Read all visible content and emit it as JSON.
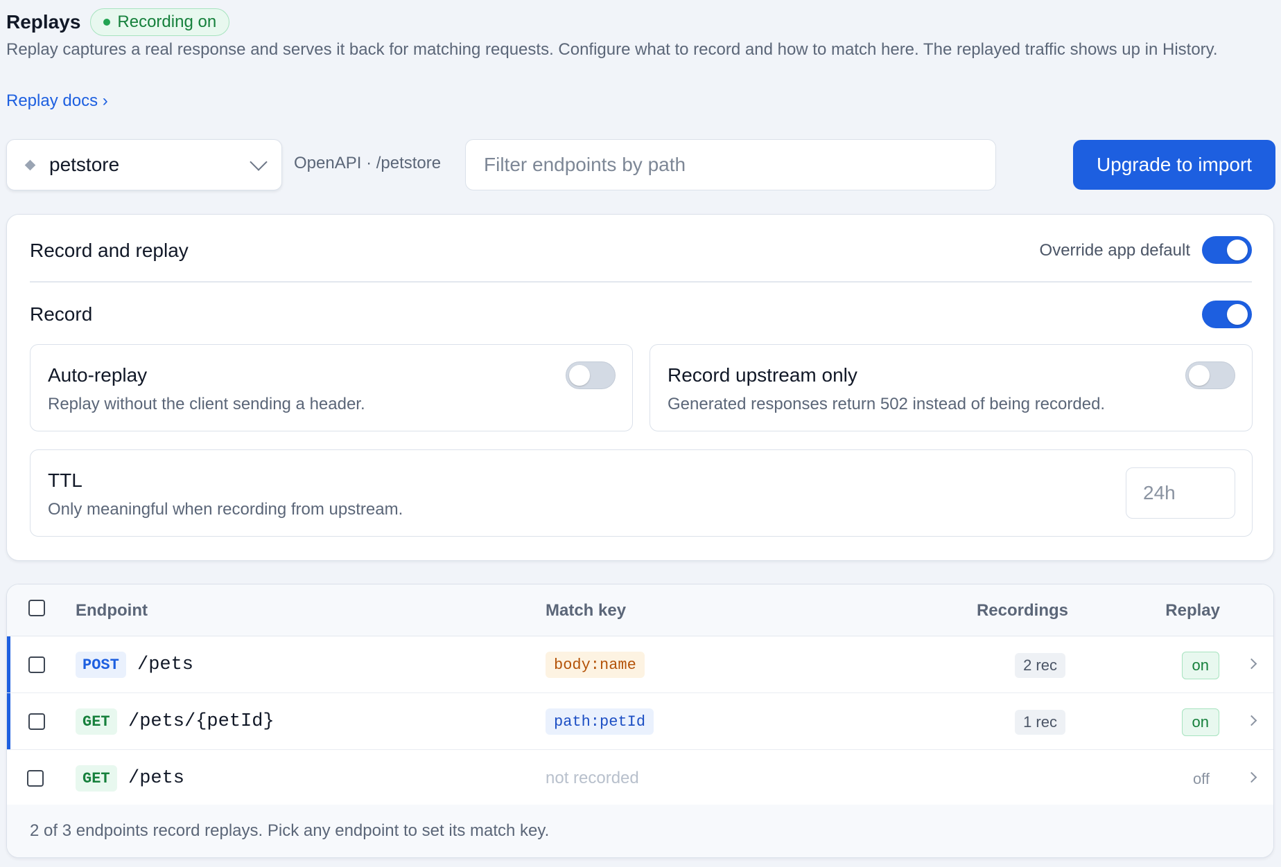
{
  "header": {
    "title": "Replays",
    "badge": "Recording on",
    "description": "Replay captures a real response and serves it back for matching requests. Configure what to record and how to match here. The replayed traffic shows up in History.",
    "docs_link": "Replay docs ›"
  },
  "toolbar": {
    "app_select": "petstore",
    "spec_label": "OpenAPI · /petstore",
    "filter_placeholder": "Filter endpoints by path",
    "filter_value": "",
    "upgrade_button": "Upgrade to import"
  },
  "settings": {
    "title": "Record and replay",
    "override_label": "Override app default",
    "override_on": true,
    "record_label": "Record",
    "record_on": true,
    "auto_replay": {
      "title": "Auto-replay",
      "description": "Replay without the client sending a header.",
      "on": false
    },
    "upstream_only": {
      "title": "Record upstream only",
      "description": "Generated responses return 502 instead of being recorded.",
      "on": false
    },
    "ttl": {
      "title": "TTL",
      "description": "Only meaningful when recording from upstream.",
      "placeholder": "24h"
    }
  },
  "table": {
    "columns": {
      "endpoint": "Endpoint",
      "match_key": "Match key",
      "recordings": "Recordings",
      "replay": "Replay"
    },
    "rows": [
      {
        "method": "POST",
        "path": "/pets",
        "match_key": "body:name",
        "recordings": "2 rec",
        "replay": "on"
      },
      {
        "method": "GET",
        "path": "/pets/{petId}",
        "match_key": "path:petId",
        "recordings": "1 rec",
        "replay": "on"
      },
      {
        "method": "GET",
        "path": "/pets",
        "match_key": "not recorded",
        "recordings": "",
        "replay": "off"
      }
    ],
    "footer": "2 of 3 endpoints record replays. Pick any endpoint to set its match key."
  },
  "colors": {
    "accent": "#1d5fe0",
    "success": "#16803c",
    "warning_text": "#b45309"
  }
}
